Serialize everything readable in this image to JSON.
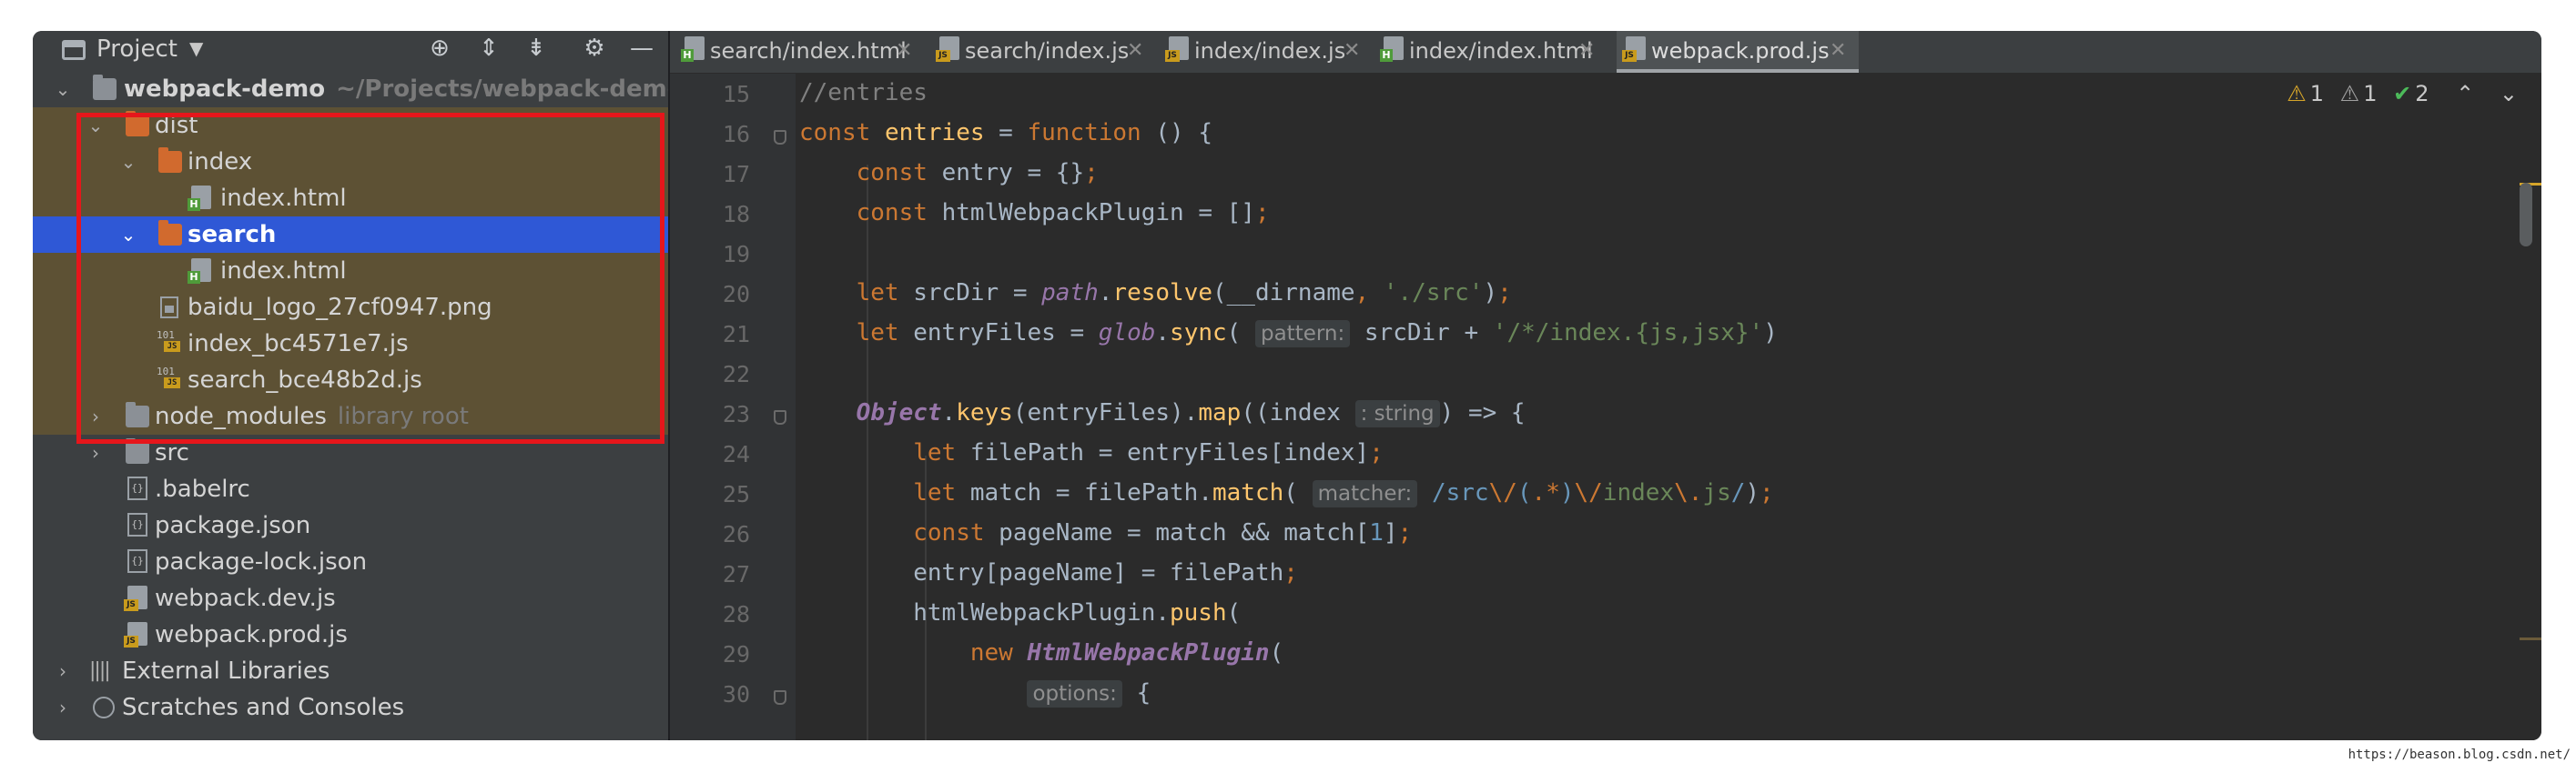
{
  "project_panel": {
    "title": "Project",
    "tools": [
      "target-icon",
      "expand-all-icon",
      "collapse-all-icon",
      "gear-icon",
      "minimize-icon"
    ],
    "tree": {
      "root": {
        "name": "webpack-demo",
        "path": "~/Projects/webpack-demo"
      },
      "dist": "dist",
      "index_folder": "index",
      "index_html": "index.html",
      "search_folder": "search",
      "search_html": "index.html",
      "baidu_logo": "baidu_logo_27cf0947.png",
      "index_js": "index_bc4571e7.js",
      "search_js": "search_bce48b2d.js",
      "node_modules": {
        "name": "node_modules",
        "hint": "library root"
      },
      "src": "src",
      "babelrc": ".babelrc",
      "package_json": "package.json",
      "package_lock": "package-lock.json",
      "webpack_dev": "webpack.dev.js",
      "webpack_prod": "webpack.prod.js",
      "external_libraries": "External Libraries",
      "scratches": "Scratches and Consoles"
    }
  },
  "tabs": [
    {
      "label": "search/index.html",
      "type": "html",
      "active": false
    },
    {
      "label": "search/index.js",
      "type": "js",
      "active": false
    },
    {
      "label": "index/index.js",
      "type": "js",
      "active": false
    },
    {
      "label": "index/index.html",
      "type": "html",
      "active": false
    },
    {
      "label": "webpack.prod.js",
      "type": "js",
      "active": true
    }
  ],
  "inspections": {
    "warnings": "1",
    "weak_warnings": "1",
    "typos": "2"
  },
  "editor": {
    "line_numbers": [
      "15",
      "16",
      "17",
      "18",
      "19",
      "20",
      "21",
      "22",
      "23",
      "24",
      "25",
      "26",
      "27",
      "28",
      "29",
      "30"
    ],
    "hints": {
      "pattern": "pattern:",
      "string_type": ": string",
      "matcher": "matcher:",
      "options": "options:"
    },
    "tokens": {
      "comment_entries": "//entries",
      "kw_const": "const",
      "kw_let": "let",
      "kw_function": "function",
      "kw_new": "new",
      "entries": "entries",
      "entry": "entry",
      "htmlWebpackPlugin": "htmlWebpackPlugin",
      "srcDir": "srcDir",
      "entryFiles": "entryFiles",
      "filePath": "filePath",
      "match": "match",
      "pageName": "pageName",
      "path": "path",
      "resolve": "resolve",
      "dirname": "__dirname",
      "src_str": "'./src'",
      "glob": "glob",
      "sync": "sync",
      "glob_str": "'/*/index.{js,jsx}'",
      "Object": "Object",
      "keys": "keys",
      "map": "map",
      "index": "index",
      "push": "push",
      "HtmlWebpackPlugin": "HtmlWebpackPlugin",
      "one": "1"
    }
  },
  "watermark": "https://beason.blog.csdn.net/"
}
